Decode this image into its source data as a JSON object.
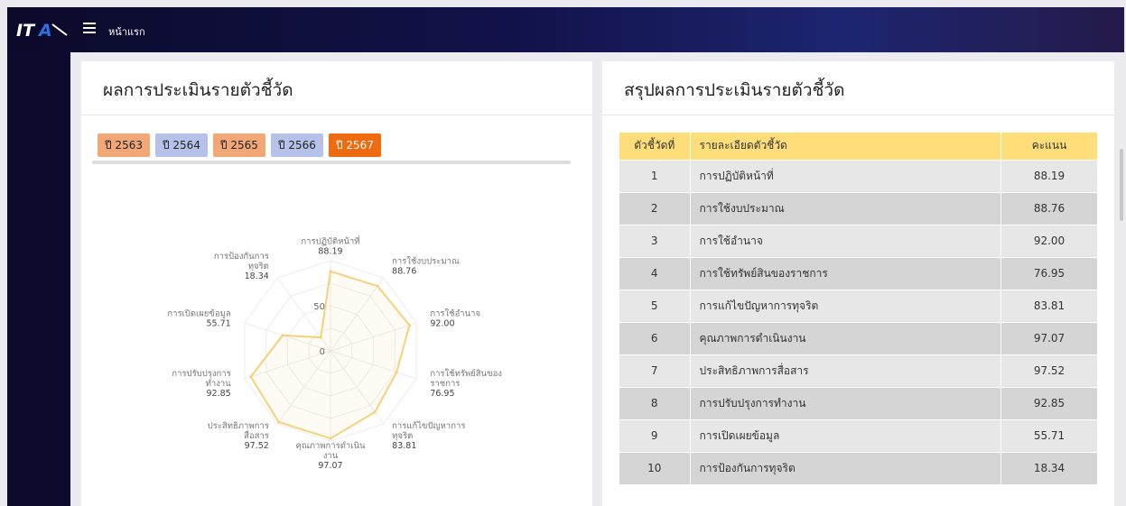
{
  "header": {
    "logo_text": "ITA",
    "home_label": "หน้าแรก"
  },
  "left_card": {
    "title": "ผลการประเมินรายตัวชี้วัด",
    "years": [
      "ปี 2563",
      "ปี 2564",
      "ปี 2565",
      "ปี 2566",
      "ปี 2567"
    ],
    "radar": {
      "scale_labels": [
        "0",
        "50"
      ],
      "axes": [
        {
          "lines": [
            "การปฏิบัติหน้าที่",
            "88.19"
          ],
          "value": 88.19
        },
        {
          "lines": [
            "การใช้งบประมาณ",
            "88.76"
          ],
          "value": 88.76
        },
        {
          "lines": [
            "การใช้อำนาจ",
            "92.00"
          ],
          "value": 92.0
        },
        {
          "lines": [
            "การใช้ทรัพย์สินของ",
            "ราชการ",
            "76.95"
          ],
          "value": 76.95
        },
        {
          "lines": [
            "การแก้ไขปัญหาการ",
            "ทุจริต",
            "83.81"
          ],
          "value": 83.81
        },
        {
          "lines": [
            "คุณภาพการดำเนิน",
            "งาน",
            "97.07"
          ],
          "value": 97.07
        },
        {
          "lines": [
            "ประสิทธิภาพการ",
            "สื่อสาร",
            "97.52"
          ],
          "value": 97.52
        },
        {
          "lines": [
            "การปรับปรุงการ",
            "ทำงาน",
            "92.85"
          ],
          "value": 92.85
        },
        {
          "lines": [
            "การเปิดเผยข้อมูล",
            "55.71"
          ],
          "value": 55.71
        },
        {
          "lines": [
            "การป้องกันการ",
            "ทุจริต",
            "18.34"
          ],
          "value": 18.34
        }
      ],
      "color": "#f3d27a"
    }
  },
  "right_card": {
    "title": "สรุปผลการประเมินรายตัวชี้วัด",
    "columns": [
      "ตัวชี้วัดที่",
      "รายละเอียดตัวชี้วัด",
      "คะแนน"
    ],
    "rows": [
      {
        "no": "1",
        "name": "การปฏิบัติหน้าที่",
        "score": "88.19"
      },
      {
        "no": "2",
        "name": "การใช้งบประมาณ",
        "score": "88.76"
      },
      {
        "no": "3",
        "name": "การใช้อำนาจ",
        "score": "92.00"
      },
      {
        "no": "4",
        "name": "การใช้ทรัพย์สินของราชการ",
        "score": "76.95"
      },
      {
        "no": "5",
        "name": "การแก้ไขปัญหาการทุจริต",
        "score": "83.81"
      },
      {
        "no": "6",
        "name": "คุณภาพการดำเนินงาน",
        "score": "97.07"
      },
      {
        "no": "7",
        "name": "ประสิทธิภาพการสื่อสาร",
        "score": "97.52"
      },
      {
        "no": "8",
        "name": "การปรับปรุงการทำงาน",
        "score": "92.85"
      },
      {
        "no": "9",
        "name": "การเปิดเผยข้อมูล",
        "score": "55.71"
      },
      {
        "no": "10",
        "name": "การป้องกันการทุจริต",
        "score": "18.34"
      }
    ]
  }
}
